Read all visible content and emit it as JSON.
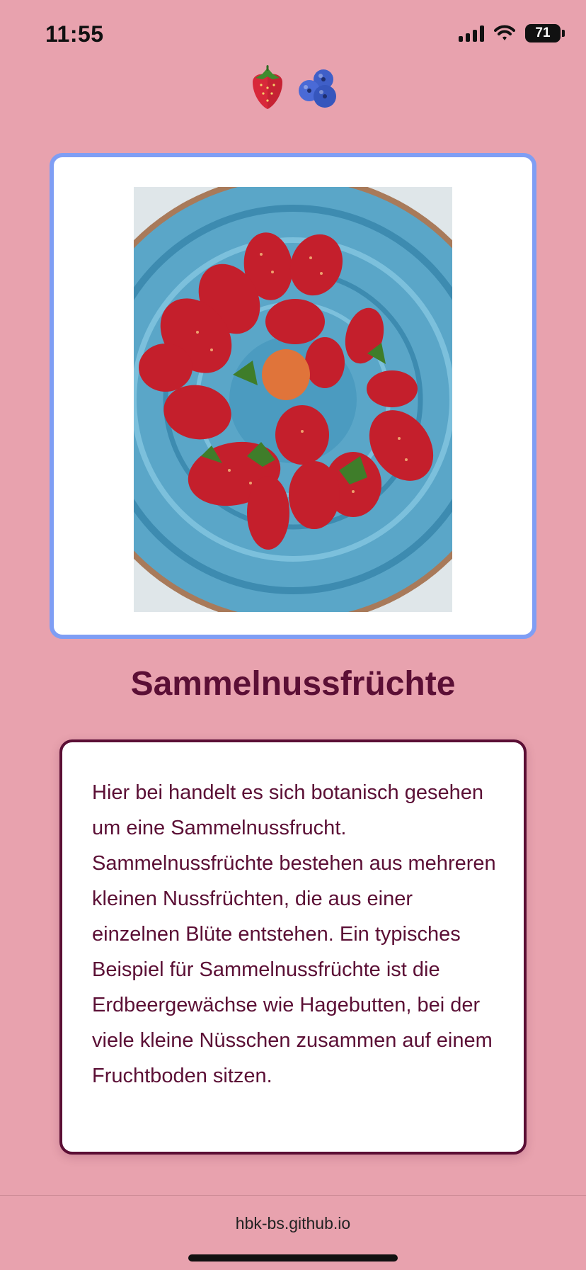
{
  "status_bar": {
    "time": "11:55",
    "battery": "71",
    "icons": [
      "signal-icon",
      "wifi-icon",
      "battery-icon"
    ]
  },
  "header": {
    "emojis": [
      "strawberry-icon",
      "blueberries-icon"
    ]
  },
  "photo": {
    "subject": "strawberry-bowl-image"
  },
  "main": {
    "title": "Sammelnussfrüchte",
    "description": "Hier bei handelt es sich botanisch gesehen um eine Sammelnussfrucht. Sammelnussfrüchte bestehen aus mehreren kleinen Nussfrüchten, die aus einer einzelnen Blüte entstehen. Ein typisches Beispiel für Sammelnussfrüchte ist die Erdbeergewächse wie Hagebutten, bei der viele kleine Nüsschen zusammen auf einem Fruchtboden sitzen."
  },
  "browser": {
    "url": "hbk-bs.github.io"
  },
  "colors": {
    "background": "#e8a2ae",
    "accent": "#5b0f35",
    "frame_border": "#7f9ef4"
  }
}
